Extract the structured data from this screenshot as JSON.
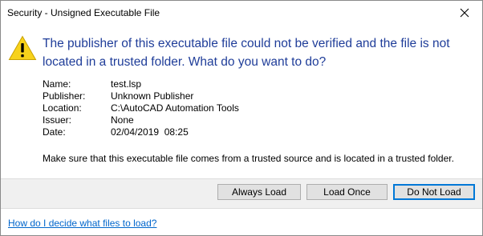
{
  "dialog": {
    "title": "Security - Unsigned Executable File",
    "heading": "The publisher of this executable file could not be verified and the file is not located in a trusted folder. What do you want to do?",
    "icon": "warning-icon",
    "accent_color": "#1f3d99",
    "warning_color": "#f7d21b"
  },
  "details": [
    {
      "label": "Name:",
      "value": "test.lsp"
    },
    {
      "label": "Publisher:",
      "value": "Unknown Publisher"
    },
    {
      "label": "Location:",
      "value": "C:\\AutoCAD Automation Tools"
    },
    {
      "label": "Issuer:",
      "value": "None"
    },
    {
      "label": "Date:",
      "value": "02/04/2019  08:25"
    }
  ],
  "note": "Make sure that this executable file comes from a trusted source and is located in a trusted folder.",
  "buttons": {
    "always_load": "Always Load",
    "load_once": "Load Once",
    "do_not_load": "Do Not Load"
  },
  "footer": {
    "help_link": "How do I decide what files to load?"
  }
}
